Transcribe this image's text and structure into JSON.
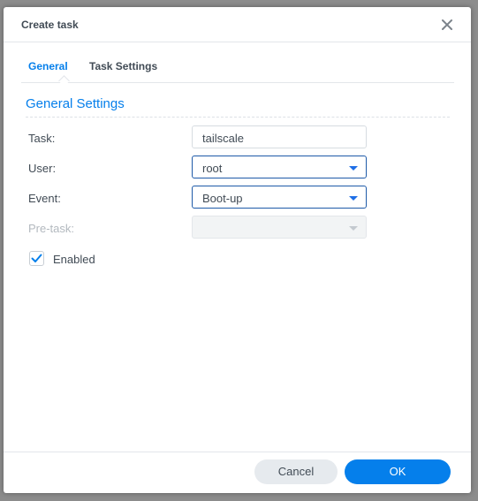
{
  "dialog": {
    "title": "Create task",
    "close_icon": "close-icon"
  },
  "tabs": [
    {
      "label": "General",
      "active": true
    },
    {
      "label": "Task Settings",
      "active": false
    }
  ],
  "section": {
    "title": "General Settings"
  },
  "form": {
    "task": {
      "label": "Task:",
      "value": "tailscale"
    },
    "user": {
      "label": "User:",
      "value": "root"
    },
    "event": {
      "label": "Event:",
      "value": "Boot-up"
    },
    "pretask": {
      "label": "Pre-task:",
      "value": ""
    },
    "enabled": {
      "label": "Enabled",
      "checked": true
    }
  },
  "buttons": {
    "cancel": "Cancel",
    "ok": "OK"
  },
  "colors": {
    "accent": "#057feb",
    "text": "#414b55",
    "focus_border": "#1e5aa8"
  }
}
